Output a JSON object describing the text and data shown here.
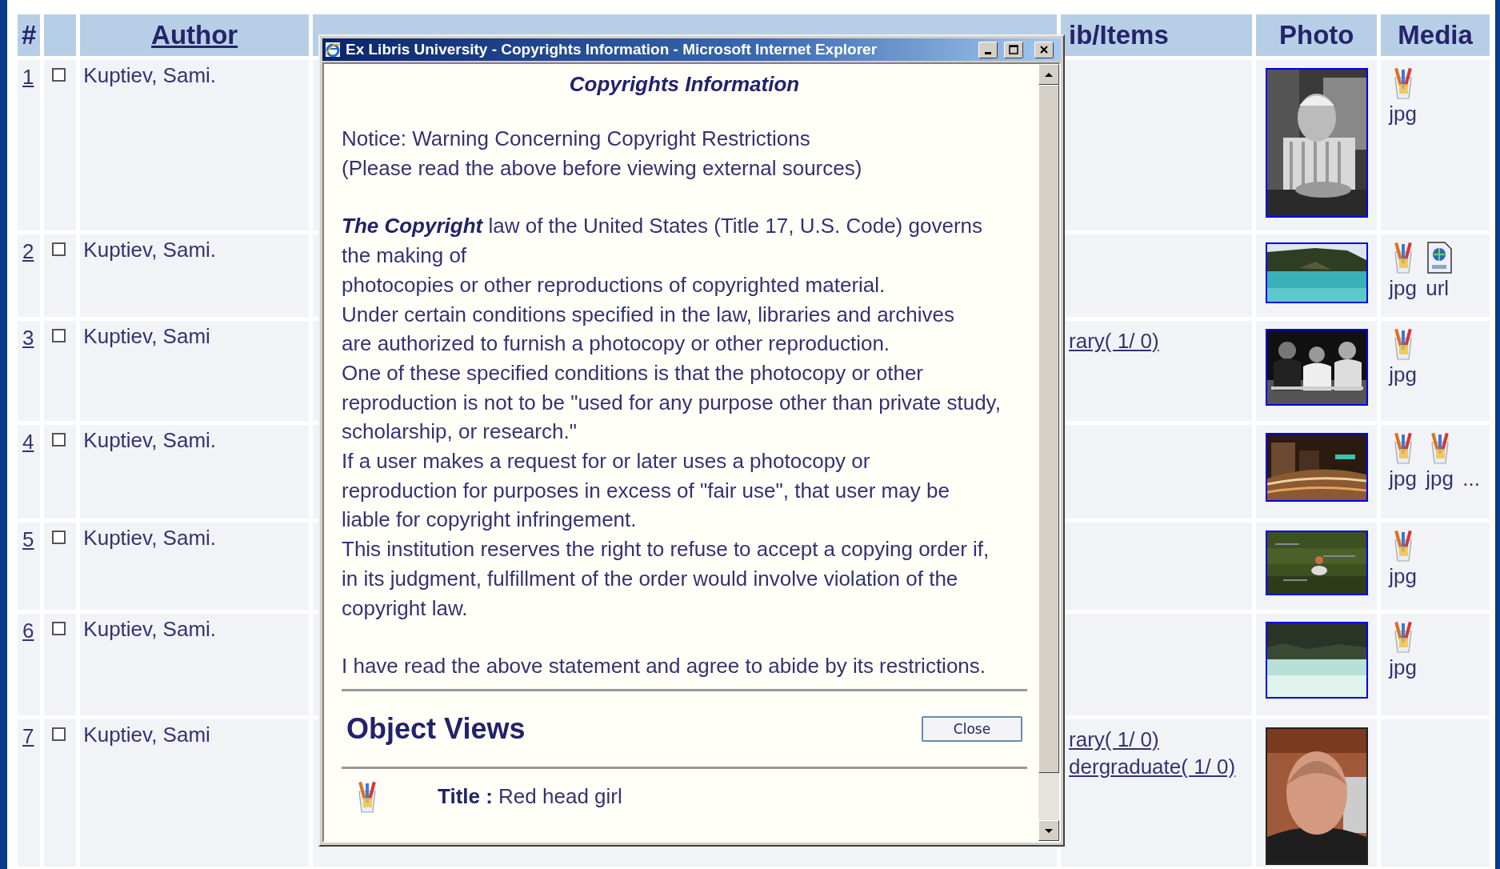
{
  "header": {
    "number": "#",
    "author": "Author",
    "items": "ib/Items",
    "photo": "Photo",
    "media": "Media"
  },
  "rows": [
    {
      "number": "1",
      "checked": false,
      "author": "Kuptiev, Sami.",
      "photo": {
        "kind": "picture"
      },
      "media": [
        {
          "label": "jpg"
        }
      ]
    },
    {
      "number": "2",
      "checked": false,
      "author": "Kuptiev, Sami.",
      "photo": {
        "kind": "picture"
      },
      "media": [
        {
          "label": "jpg"
        },
        {
          "kind": "link",
          "label": "url"
        }
      ]
    },
    {
      "number": "3",
      "checked": false,
      "author": "Kuptiev, Sami",
      "items": [
        "rary( 1/ 0)"
      ],
      "photo": {
        "kind": "picture"
      },
      "media": [
        {
          "label": "jpg"
        }
      ]
    },
    {
      "number": "4",
      "checked": false,
      "author": "Kuptiev, Sami.",
      "photo": {
        "kind": "picture"
      },
      "media": [
        {
          "label": "jpg"
        },
        {
          "label": "jpg"
        }
      ],
      "more": "..."
    },
    {
      "number": "5",
      "checked": false,
      "author": "Kuptiev, Sami.",
      "photo": {
        "kind": "picture"
      },
      "media": [
        {
          "label": "jpg"
        }
      ]
    },
    {
      "number": "6",
      "checked": false,
      "author": "Kuptiev, Sami.",
      "photo": {
        "kind": "picture"
      },
      "media": [
        {
          "label": "jpg"
        }
      ]
    },
    {
      "number": "7",
      "checked": false,
      "author": "Kuptiev, Sami",
      "items": [
        "rary( 1/ 0)",
        "dergraduate( 1/ 0)"
      ],
      "photo": {
        "kind": "picture"
      }
    }
  ],
  "popup": {
    "title": "Ex Libris University - Copyrights Information - Microsoft Internet Explorer",
    "heading": "Copyrights Information",
    "notice": [
      "Notice: Warning Concerning Copyright Restrictions",
      "(Please read the above before viewing external sources)"
    ],
    "law": [
      "*The Copyright* law of the United States (Title 17, U.S. Code) governs",
      "the making of",
      "photocopies or other reproductions of copyrighted material.",
      "Under certain conditions specified in the law, libraries and archives",
      "are authorized to furnish a photocopy or other reproduction.",
      "One of these specified conditions is that the photocopy or other",
      "reproduction is not to be \"used for any purpose other than private study,",
      "scholarship, or research.\"",
      "If a user makes a request for or later uses a photocopy or",
      "reproduction for purposes in excess of \"fair use\", that user may be",
      "liable for copyright infringement.",
      "This institution reserves the right to refuse to accept a copying order if,",
      "in its judgment, fulfillment of the order would involve violation of the",
      "copyright law."
    ],
    "agreement": "I have read the above statement and agree to abide by its restrictions.",
    "section_title": "Object Views",
    "close_button": "Close",
    "object": {
      "label": "Title :",
      "value": "Red head girl"
    }
  }
}
